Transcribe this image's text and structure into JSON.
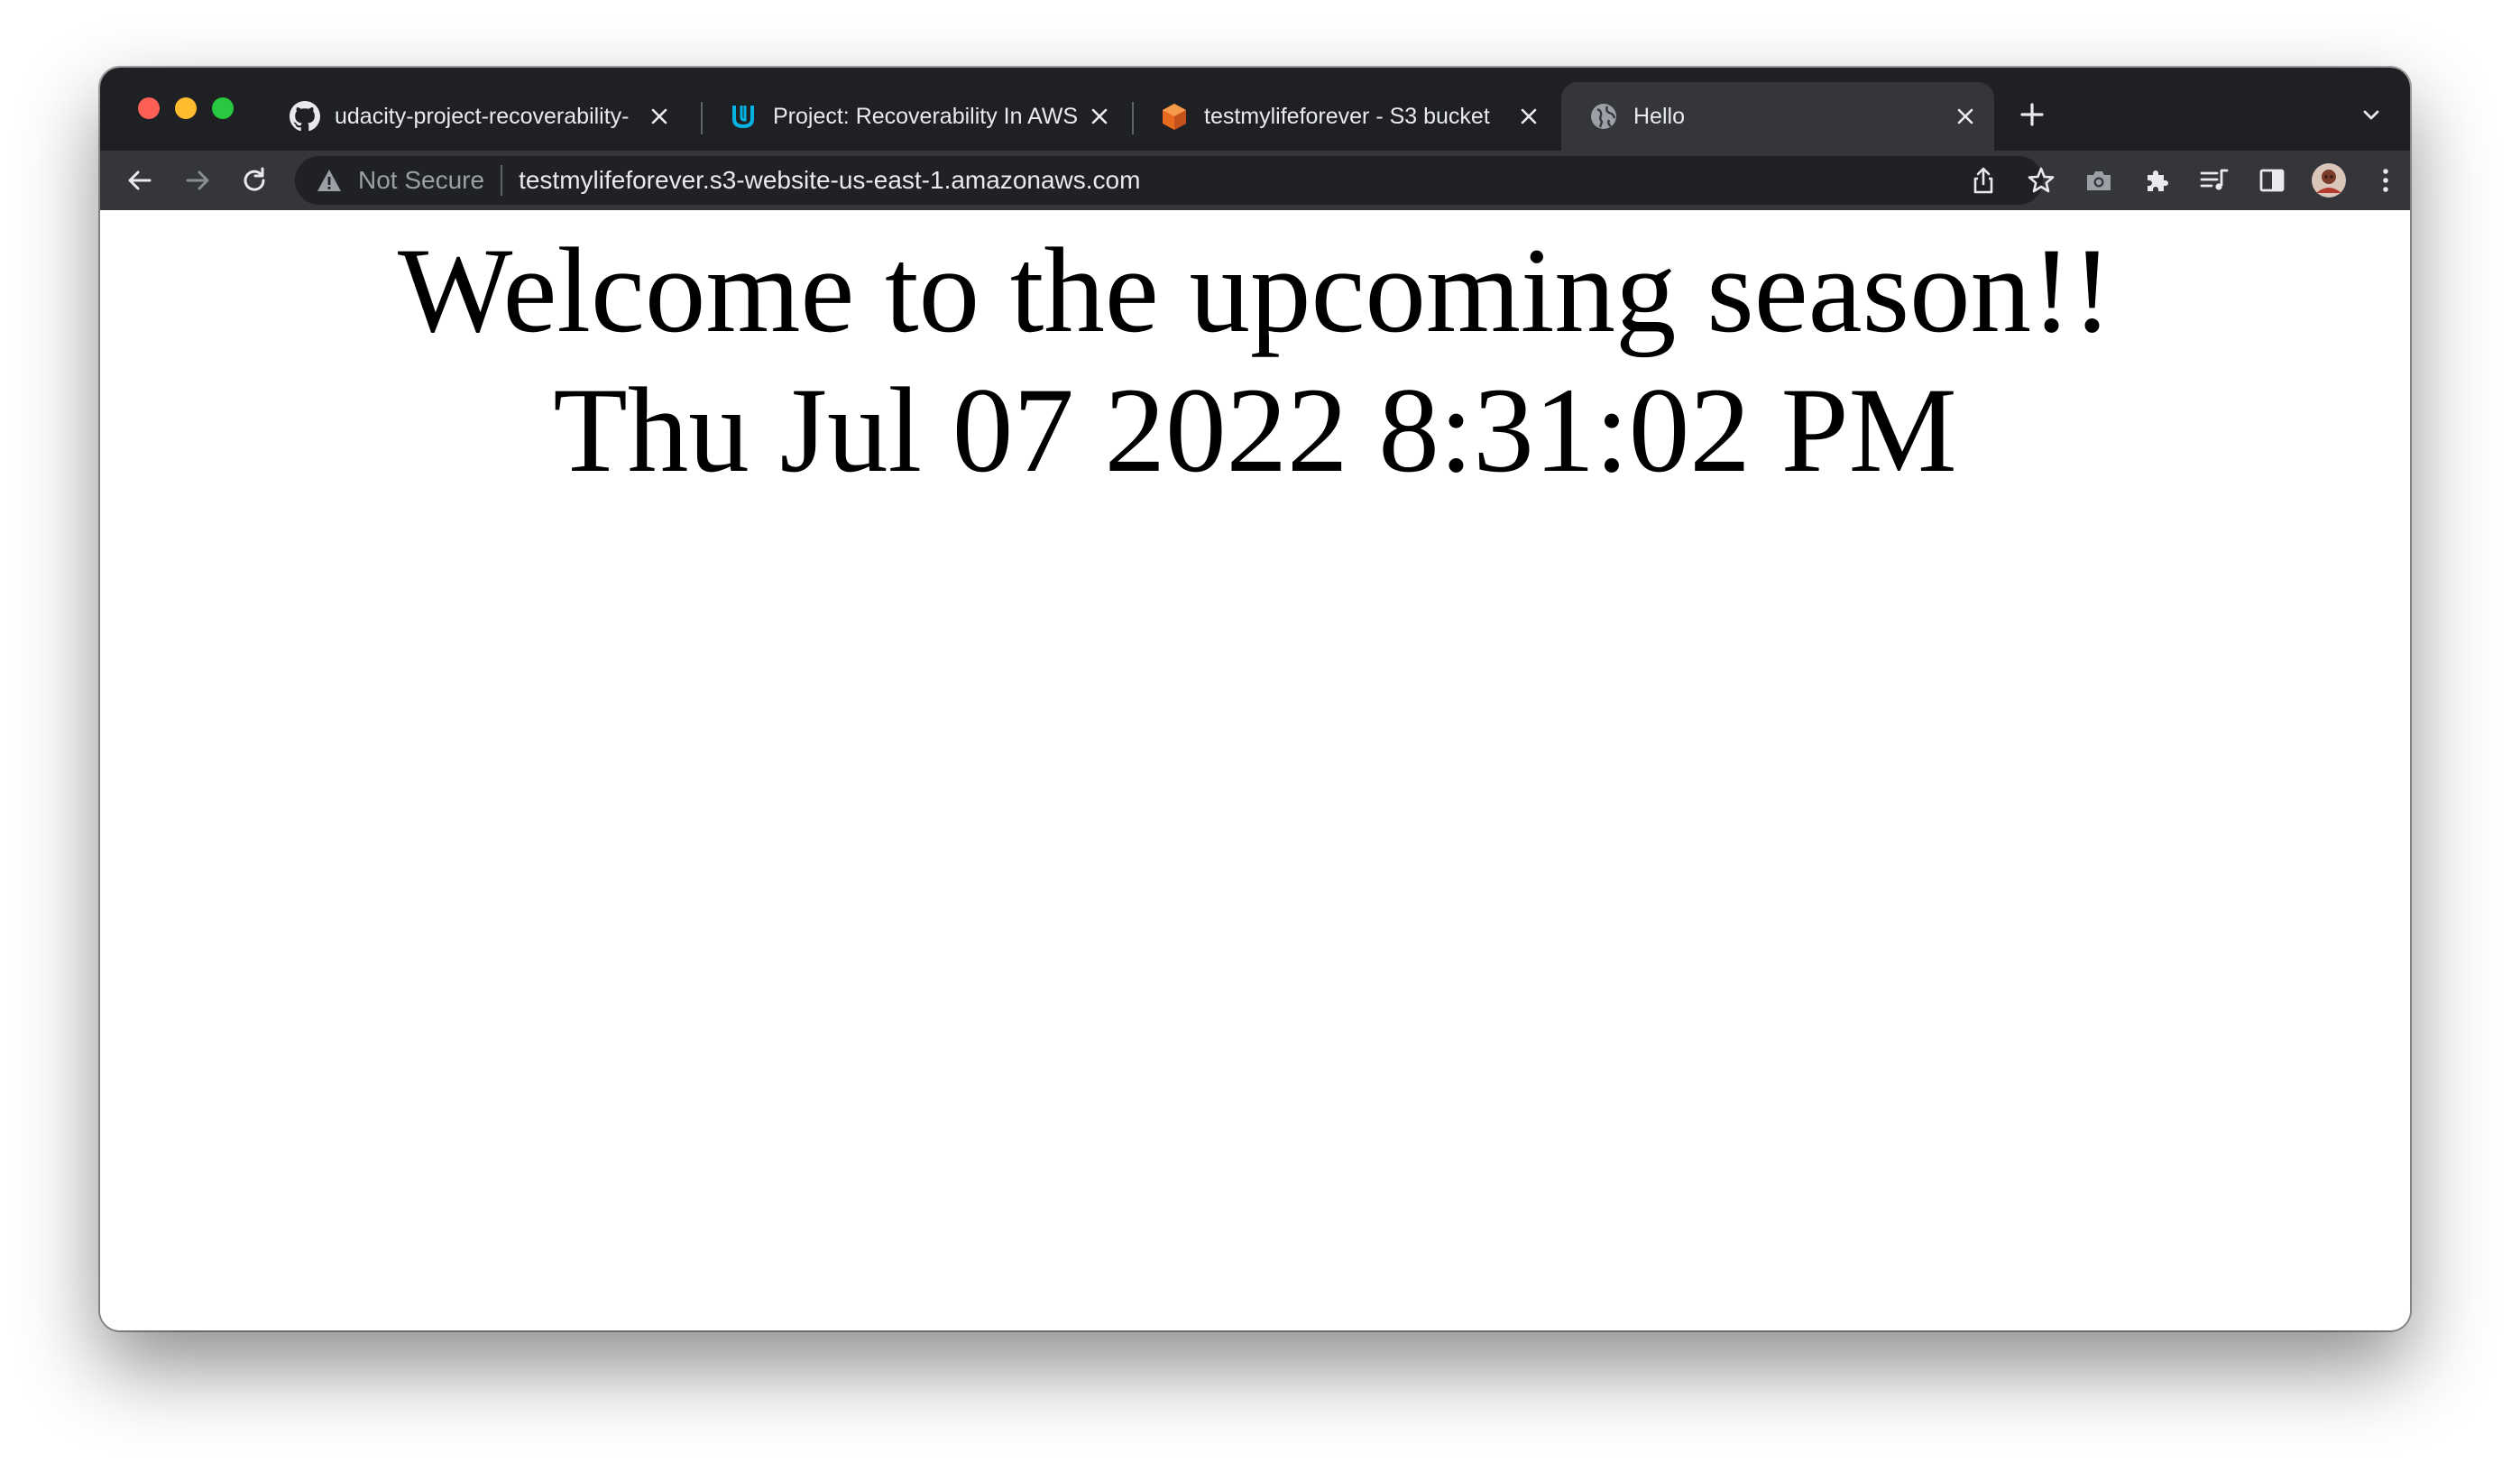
{
  "browser": {
    "tabs": [
      {
        "title": "udacity-project-recoverability-",
        "icon": "github-icon",
        "active": false
      },
      {
        "title": "Project: Recoverability In AWS",
        "icon": "udacity-icon",
        "active": false
      },
      {
        "title": "testmylifeforever - S3 bucket",
        "icon": "aws-s3-icon",
        "active": false
      },
      {
        "title": "Hello",
        "icon": "globe-icon",
        "active": true
      }
    ],
    "new_tab_symbol": "+",
    "address_bar": {
      "security_label": "Not Secure",
      "url": "testmylifeforever.s3-website-us-east-1.amazonaws.com"
    },
    "colors": {
      "frame": "#1f2023",
      "toolbar": "#35363a",
      "omnibox": "#202124",
      "text": "#e8eaed",
      "muted": "#9aa0a6"
    }
  },
  "page": {
    "heading": "Welcome to the upcoming season!!",
    "datetime": "Thu Jul 07 2022 8:31:02 PM"
  }
}
